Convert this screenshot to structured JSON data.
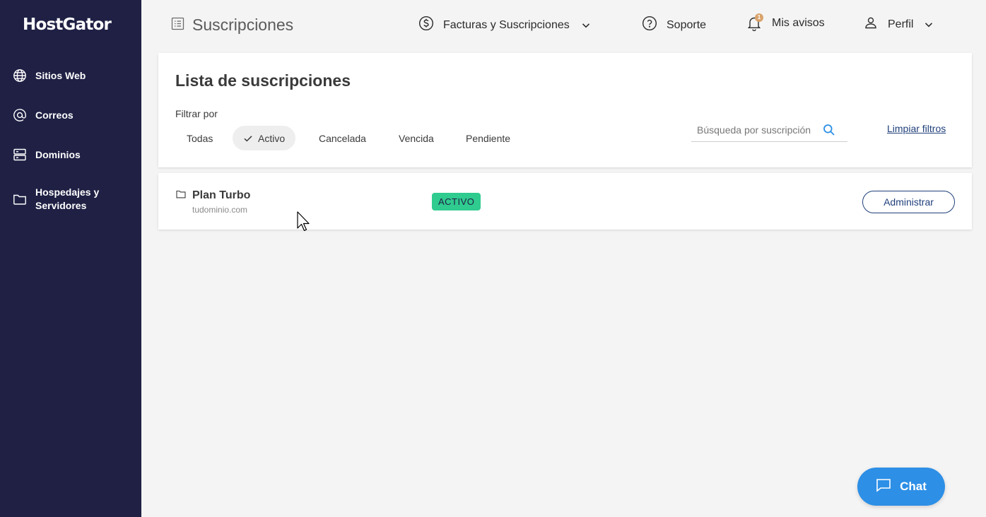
{
  "app": {
    "logo": "HostGator"
  },
  "sidebar": {
    "items": [
      {
        "label": "Sitios Web",
        "icon": "globe-icon"
      },
      {
        "label": "Correos",
        "icon": "at-sign-icon"
      },
      {
        "label": "Dominios",
        "icon": "server-icon"
      },
      {
        "label": "Hospedajes y Servidores",
        "icon": "folder-icon"
      }
    ]
  },
  "header": {
    "title": "Suscripciones",
    "nav": {
      "billing": "Facturas y Suscripciones",
      "support": "Soporte",
      "notices": "Mis avisos",
      "notices_count": "1",
      "profile": "Perfil"
    }
  },
  "filters": {
    "title": "Lista de suscripciones",
    "filter_label": "Filtrar por",
    "chips": [
      "Todas",
      "Activo",
      "Cancelada",
      "Vencida",
      "Pendiente"
    ],
    "selected": "Activo",
    "search_placeholder": "Búsqueda por suscripción",
    "clear": "Limpiar filtros"
  },
  "subscriptions": [
    {
      "name": "Plan Turbo",
      "domain": "tudominio.com",
      "status": "ACTIVO",
      "action": "Administrar"
    }
  ],
  "chat": {
    "label": "Chat"
  },
  "colors": {
    "sidebar": "#1f2044",
    "accent": "#2d8fe6",
    "status_active": "#2fcb8f",
    "link": "#1f3f7a"
  }
}
